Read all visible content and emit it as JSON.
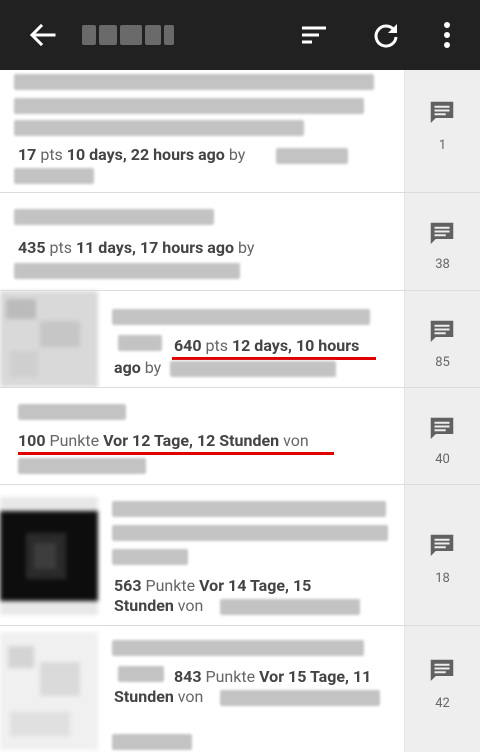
{
  "appbar": {
    "back_icon": "back-arrow-icon",
    "sort_icon": "sort-icon",
    "refresh_icon": "refresh-icon",
    "more_icon": "more-vertical-icon"
  },
  "items": [
    {
      "points_num": "17",
      "points_label": "pts",
      "time": "10 days, 22 hours ago",
      "by": "by",
      "comments": "1"
    },
    {
      "points_num": "435",
      "points_label": "pts",
      "time": "11 days, 17 hours ago",
      "by": "by",
      "comments": "38"
    },
    {
      "points_num": "640",
      "points_label": "pts",
      "time": "12 days, 10 hours",
      "time2": "ago",
      "by": "by",
      "comments": "85"
    },
    {
      "points_num": "100",
      "points_label": "Punkte",
      "time": "Vor 12 Tage, 12 Stunden",
      "by": "von",
      "comments": "40"
    },
    {
      "points_num": "563",
      "points_label": "Punkte",
      "time": "Vor 14 Tage, 15",
      "time2": "Stunden",
      "by": "von",
      "comments": "18"
    },
    {
      "points_num": "843",
      "points_label": "Punkte",
      "time": "Vor 15 Tage, 11",
      "time2": "Stunden",
      "by": "von",
      "comments": "42"
    }
  ],
  "colors": {
    "appbar": "#212121",
    "accent_underline": "#e00000",
    "side": "#eeeeee",
    "comment_icon": "#616161"
  }
}
